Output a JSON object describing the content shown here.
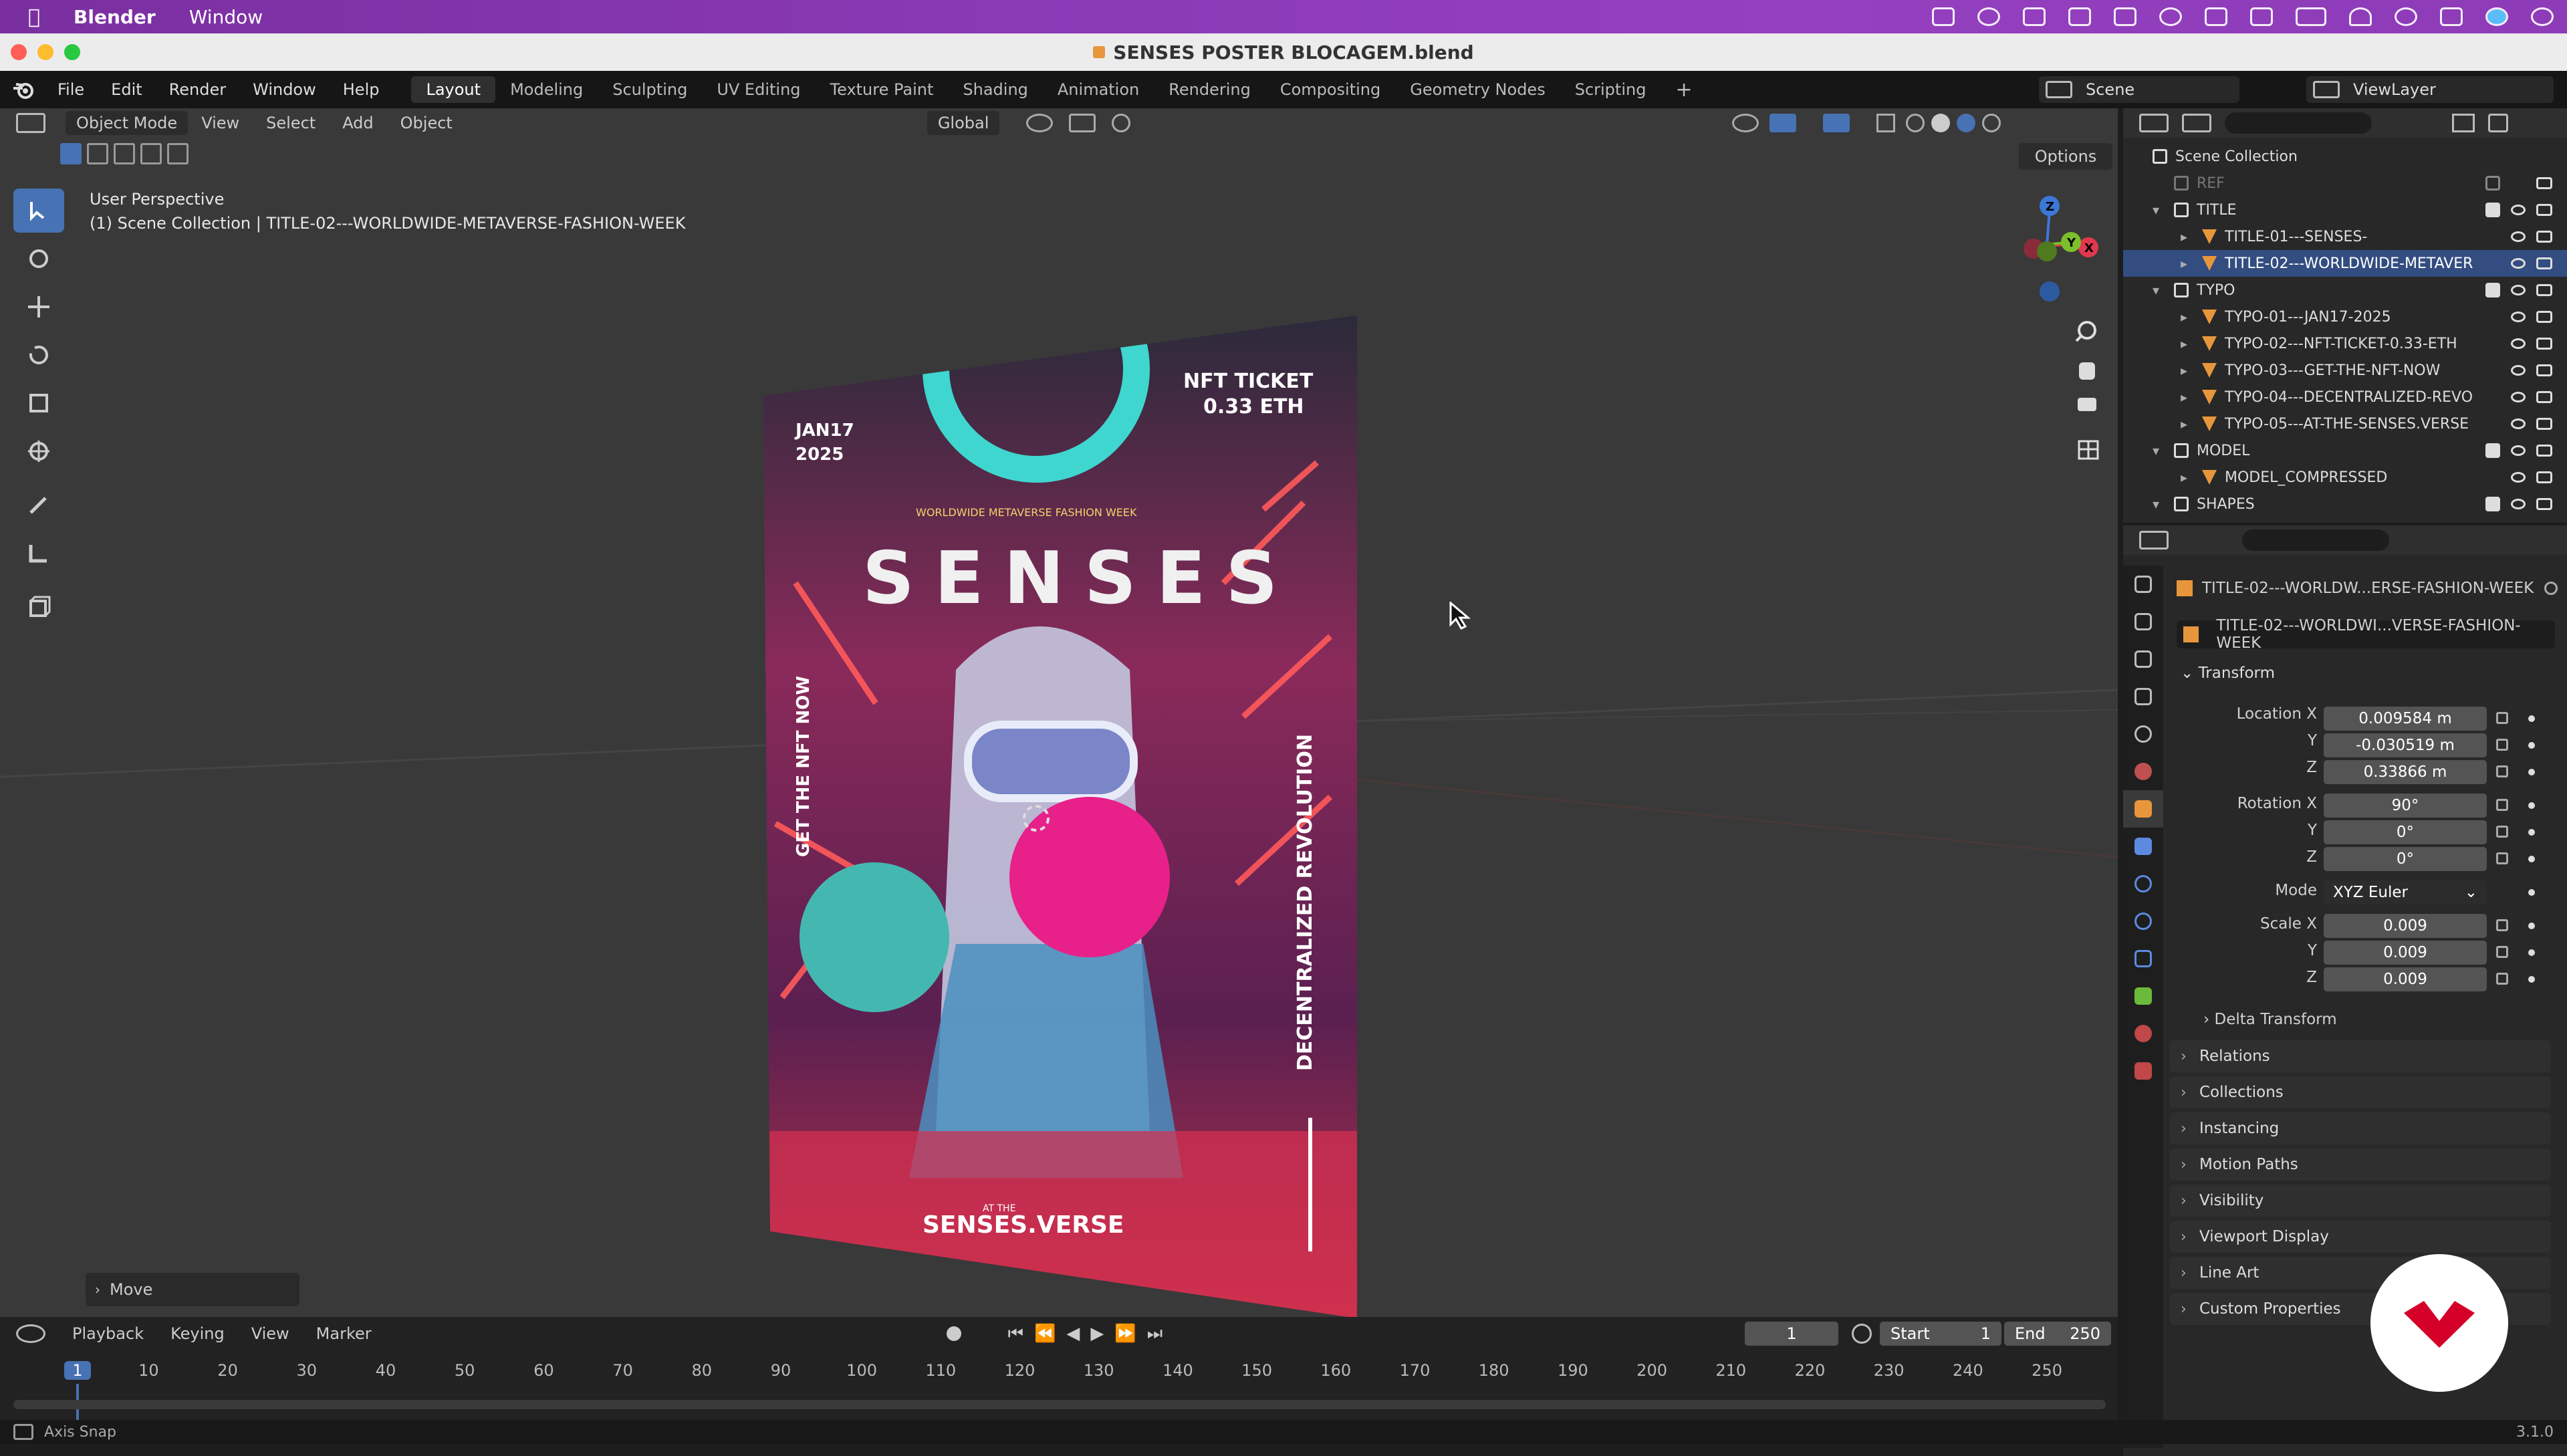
{
  "mac_menubar": {
    "apple": "",
    "app": "Blender",
    "window": "Window"
  },
  "titlebar": {
    "title": "SENSES POSTER BLOCAGEM.blend"
  },
  "topbar": {
    "menus": [
      "File",
      "Edit",
      "Render",
      "Window",
      "Help"
    ],
    "workspaces": [
      "Layout",
      "Modeling",
      "Sculpting",
      "UV Editing",
      "Texture Paint",
      "Shading",
      "Animation",
      "Rendering",
      "Compositing",
      "Geometry Nodes",
      "Scripting"
    ],
    "active_workspace": "Layout",
    "add_tab": "+",
    "scene": "Scene",
    "view_layer": "ViewLayer"
  },
  "viewport": {
    "mode": "Object Mode",
    "menus": [
      "View",
      "Select",
      "Add",
      "Object"
    ],
    "orientation": "Global",
    "options": "Options",
    "overlay_line1": "User Perspective",
    "overlay_line2": "(1) Scene Collection | TITLE-02---WORLDWIDE-METAVERSE-FASHION-WEEK",
    "last_op": "Move",
    "gizmo_axes": {
      "z": "Z",
      "y": "Y",
      "x": "X"
    },
    "poster": {
      "date": "JAN17\n2025",
      "date_l1": "JAN17",
      "date_l2": "2025",
      "ticket_l1": "NFT TICKET",
      "ticket_l2": "0.33 ETH",
      "title": "SENSES",
      "subtitle": "WORLDWIDE METAVERSE FASHION WEEK",
      "side_left": "GET THE NFT NOW",
      "side_right": "DECENTRALIZED REVOLUTION",
      "at_the": "AT THE",
      "footer": "SENSES.VERSE"
    }
  },
  "outliner": {
    "root": "Scene Collection",
    "rows": [
      {
        "label": "REF",
        "indent": 1,
        "type": "collection",
        "dim": true
      },
      {
        "label": "TITLE",
        "indent": 1,
        "type": "collection"
      },
      {
        "label": "TITLE-01---SENSES-",
        "indent": 2,
        "type": "object"
      },
      {
        "label": "TITLE-02---WORLDWIDE-METAVER",
        "indent": 2,
        "type": "object",
        "selected": true
      },
      {
        "label": "TYPO",
        "indent": 1,
        "type": "collection"
      },
      {
        "label": "TYPO-01---JAN17-2025",
        "indent": 2,
        "type": "object"
      },
      {
        "label": "TYPO-02---NFT-TICKET-0.33-ETH",
        "indent": 2,
        "type": "object"
      },
      {
        "label": "TYPO-03---GET-THE-NFT-NOW",
        "indent": 2,
        "type": "object"
      },
      {
        "label": "TYPO-04---DECENTRALIZED-REVO",
        "indent": 2,
        "type": "object"
      },
      {
        "label": "TYPO-05---AT-THE-SENSES.VERSE",
        "indent": 2,
        "type": "object"
      },
      {
        "label": "MODEL",
        "indent": 1,
        "type": "collection"
      },
      {
        "label": "MODEL_COMPRESSED",
        "indent": 2,
        "type": "object"
      },
      {
        "label": "SHAPES",
        "indent": 1,
        "type": "collection"
      }
    ]
  },
  "properties": {
    "object_name": "TITLE-02---WORLDW...ERSE-FASHION-WEEK",
    "data_name": "TITLE-02---WORLDWI...VERSE-FASHION-WEEK",
    "transform_label": "Transform",
    "location_label": "Location X",
    "y_label": "Y",
    "z_label": "Z",
    "rotation_label": "Rotation X",
    "mode_label": "Mode",
    "scale_label": "Scale X",
    "location": {
      "x": "0.009584 m",
      "y": "-0.030519 m",
      "z": "0.33866 m"
    },
    "rotation": {
      "x": "90°",
      "y": "0°",
      "z": "0°"
    },
    "rotation_mode": "XYZ Euler",
    "scale": {
      "x": "0.009",
      "y": "0.009",
      "z": "0.009"
    },
    "delta_transform": "Delta Transform",
    "panels": [
      "Relations",
      "Collections",
      "Instancing",
      "Motion Paths",
      "Visibility",
      "Viewport Display",
      "Line Art",
      "Custom Properties"
    ]
  },
  "timeline": {
    "menus": [
      "Playback",
      "Keying",
      "View",
      "Marker"
    ],
    "current_frame": "1",
    "start_label": "Start",
    "start": "1",
    "end_label": "End",
    "end": "250",
    "ticks": [
      "1",
      "10",
      "20",
      "30",
      "40",
      "50",
      "60",
      "70",
      "80",
      "90",
      "100",
      "110",
      "120",
      "130",
      "140",
      "150",
      "160",
      "170",
      "180",
      "190",
      "200",
      "210",
      "220",
      "230",
      "240",
      "250"
    ]
  },
  "statusbar": {
    "hint": "Axis Snap",
    "version": "3.1.0"
  },
  "colors": {
    "accent": "#4772b3",
    "selection": "#334d80",
    "object_orange": "#e8963c",
    "x_axis": "#e0384f",
    "y_axis": "#7bbf2a",
    "z_axis": "#3c78d8"
  }
}
